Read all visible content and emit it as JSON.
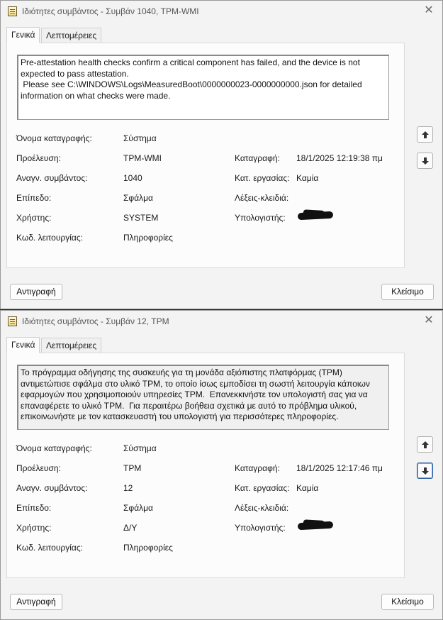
{
  "windows": [
    {
      "title": "Ιδιότητες συμβάντος - Συμβάν 1040, TPM-WMI",
      "tabs": [
        "Γενικά",
        "Λεπτομέρειες"
      ],
      "message": "Pre-attestation health checks confirm a critical component has failed, and the device is not expected to pass attestation.\n Please see C:\\WINDOWS\\Logs\\MeasuredBoot\\0000000023-0000000000.json for detailed information on what checks were made.",
      "fields": {
        "log_name_label": "Όνομα καταγραφής:",
        "log_name": "Σύστημα",
        "source_label": "Προέλευση:",
        "source": "TPM-WMI",
        "logged_label": "Καταγραφή:",
        "logged": "18/1/2025 12:19:38 πμ",
        "event_id_label": "Αναγν. συμβάντος:",
        "event_id": "1040",
        "task_label": "Κατ. εργασίας:",
        "task": "Καμία",
        "level_label": "Επίπεδο:",
        "level": "Σφάλμα",
        "keywords_label": "Λέξεις-κλειδιά:",
        "keywords": "",
        "user_label": "Χρήστης:",
        "user": "SYSTEM",
        "computer_label": "Υπολογιστής:",
        "opcode_label": "Κωδ. λειτουργίας:",
        "opcode": "Πληροφορίες"
      },
      "buttons": {
        "copy": "Αντιγραφή",
        "close": "Κλείσιμο"
      }
    },
    {
      "title": "Ιδιότητες συμβάντος - Συμβάν 12, TPM",
      "tabs": [
        "Γενικά",
        "Λεπτομέρειες"
      ],
      "message": "Το πρόγραμμα οδήγησης της συσκευής για τη μονάδα αξιόπιστης πλατφόρμας (TPM) αντιμετώπισε σφάλμα στο υλικό TPM, το οποίο ίσως εμποδίσει τη σωστή λειτουργία κάποιων εφαρμογών που χρησιμοποιούν υπηρεσίες TPM.  Επανεκκινήστε τον υπολογιστή σας για να επαναφέρετε το υλικό TPM.  Για περαιτέρω βοήθεια σχετικά με αυτό το πρόβλημα υλικού, επικοινωνήστε με τον κατασκευαστή του υπολογιστή για περισσότερες πληροφορίες.",
      "fields": {
        "log_name_label": "Όνομα καταγραφής:",
        "log_name": "Σύστημα",
        "source_label": "Προέλευση:",
        "source": "TPM",
        "logged_label": "Καταγραφή:",
        "logged": "18/1/2025 12:17:46 πμ",
        "event_id_label": "Αναγν. συμβάντος:",
        "event_id": "12",
        "task_label": "Κατ. εργασίας:",
        "task": "Καμία",
        "level_label": "Επίπεδο:",
        "level": "Σφάλμα",
        "keywords_label": "Λέξεις-κλειδιά:",
        "keywords": "",
        "user_label": "Χρήστης:",
        "user": "Δ/Υ",
        "computer_label": "Υπολογιστής:",
        "opcode_label": "Κωδ. λειτουργίας:",
        "opcode": "Πληροφορίες"
      },
      "buttons": {
        "copy": "Αντιγραφή",
        "close": "Κλείσιμο"
      }
    }
  ],
  "icons": {
    "app": "event-viewer-icon",
    "close": "close-icon",
    "up": "arrow-up-icon",
    "down": "arrow-down-icon"
  }
}
